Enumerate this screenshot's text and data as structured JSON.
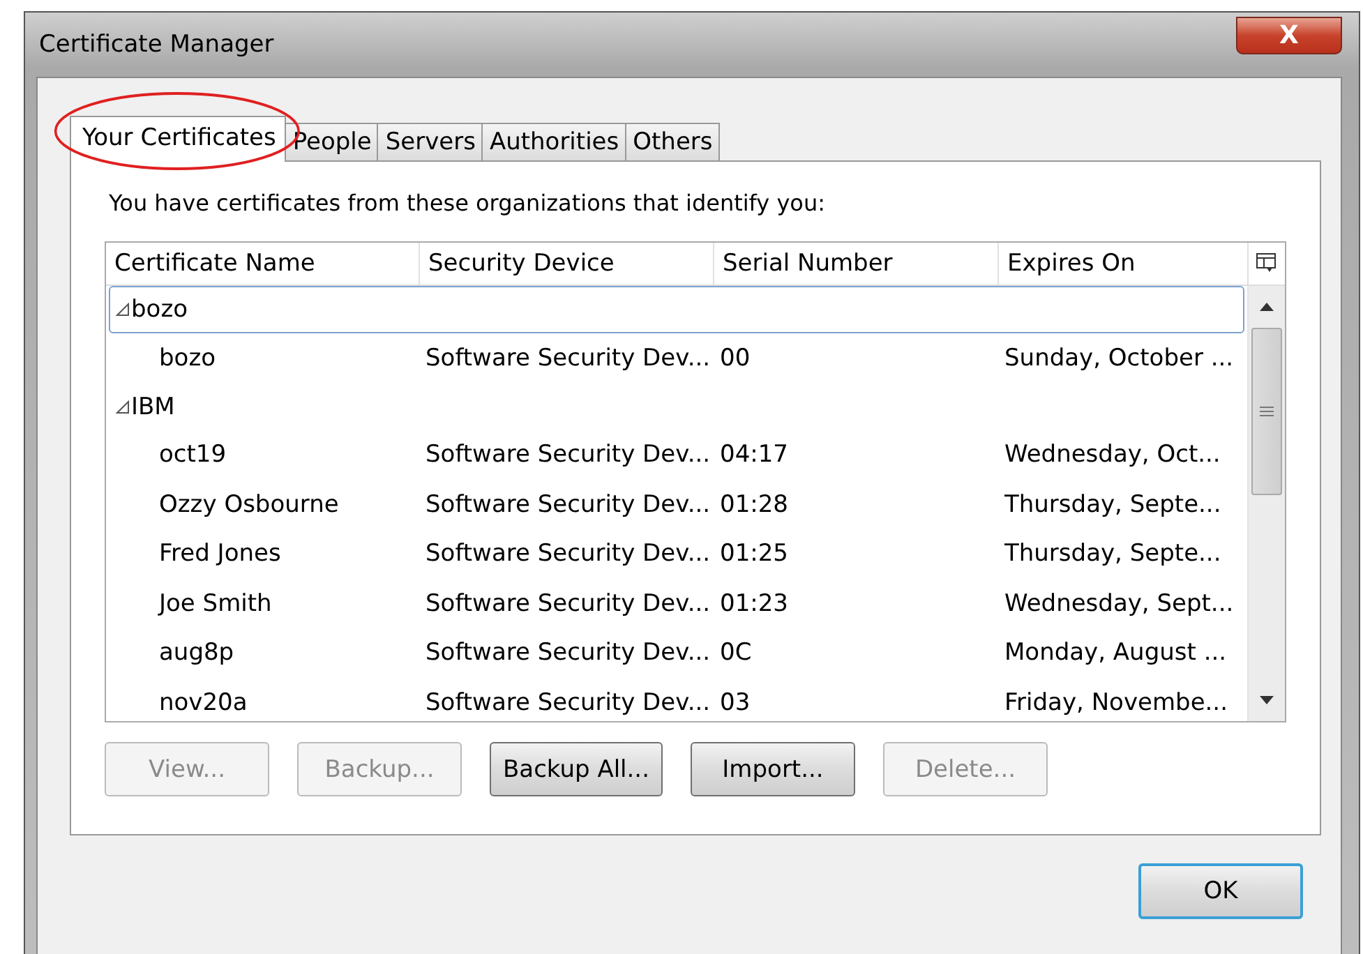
{
  "window": {
    "title": "Certificate Manager",
    "close": "X"
  },
  "tabs": [
    {
      "label": "Your Certificates",
      "selected": true,
      "circled": true
    },
    {
      "label": "People",
      "selected": false,
      "circled": false
    },
    {
      "label": "Servers",
      "selected": false,
      "circled": false
    },
    {
      "label": "Authorities",
      "selected": false,
      "circled": false
    },
    {
      "label": "Others",
      "selected": false,
      "circled": false
    }
  ],
  "intro": "You have certificates from these organizations that identify you:",
  "table": {
    "columns": [
      "Certificate Name",
      "Security Device",
      "Serial Number",
      "Expires On"
    ],
    "groups": [
      {
        "name": "bozo",
        "expanded": true,
        "selected": true,
        "children": [
          {
            "cells": [
              "bozo",
              "Software Security Dev...",
              "00",
              "Sunday, October ..."
            ]
          }
        ]
      },
      {
        "name": "IBM",
        "expanded": true,
        "selected": false,
        "children": [
          {
            "cells": [
              "oct19",
              "Software Security Dev...",
              "04:17",
              "Wednesday, Oct..."
            ]
          },
          {
            "cells": [
              "Ozzy Osbourne",
              "Software Security Dev...",
              "01:28",
              "Thursday, Septe..."
            ]
          },
          {
            "cells": [
              "Fred Jones",
              "Software Security Dev...",
              "01:25",
              "Thursday, Septe..."
            ]
          },
          {
            "cells": [
              "Joe Smith",
              "Software Security Dev...",
              "01:23",
              "Wednesday, Sept..."
            ]
          },
          {
            "cells": [
              "aug8p",
              "Software Security Dev...",
              "0C",
              "Monday, August ..."
            ]
          },
          {
            "cells": [
              "nov20a",
              "Software Security Dev...",
              "03",
              "Friday, Novembe..."
            ]
          }
        ]
      }
    ]
  },
  "actions": [
    {
      "label": "View...",
      "disabled": true
    },
    {
      "label": "Backup...",
      "disabled": true
    },
    {
      "label": "Backup All...",
      "disabled": false
    },
    {
      "label": "Import...",
      "disabled": false
    },
    {
      "label": "Delete...",
      "disabled": true
    }
  ],
  "ok": {
    "label": "OK",
    "default": true
  }
}
